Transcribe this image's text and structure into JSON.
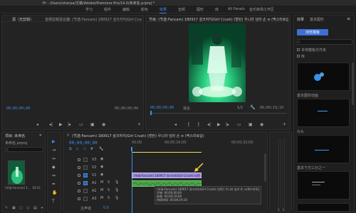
{
  "window": {
    "title": "Pr - /Users/sherpa/文稿/Adobe/Premiere Pro/14.0/未命名.prproj *"
  },
  "menu": {
    "items": [
      {
        "label": "学习"
      },
      {
        "label": "组件"
      },
      {
        "label": "编辑"
      },
      {
        "label": "颜色"
      },
      {
        "label": "效果"
      },
      {
        "label": "音频"
      },
      {
        "label": "图形"
      },
      {
        "label": "库"
      },
      {
        "label": "All Panels"
      },
      {
        "label": "音乐转场工作区"
      }
    ],
    "active_index": 4
  },
  "source_panel": {
    "tab_label": "源（无剪辑）",
    "tab2_label": "音频剪辑混合器: (节选-Fancam) 180917 설크자지(Girl Crush)",
    "timecode_left": "00;00;00;00",
    "timecode_right": "00;00;00;00"
  },
  "program_panel": {
    "tab_label": "节目: (节选-Fancam) 180917 설크자지(Girl Crush) (방탄) 우니라 넘라 손 ≡ (찍스미로샵)",
    "timecode_left": "00;00;00;00",
    "fit_label": "适合",
    "scale_label": "1/2",
    "timecode_right": "00;00;19;10"
  },
  "effects_panel": {
    "tab1": "效果",
    "tab2": "基本图形",
    "browse_button": "浏览模板",
    "my_templates": "本地模板文件夹",
    "checkbox_label": "库",
    "section_labels": [
      "基本图形动画",
      "片头",
      "基本下方三分之一"
    ]
  },
  "project_panel": {
    "tab_label": "项目: 未命名",
    "file_label": "未命名.prproj",
    "search_placeholder": "",
    "clip_label": "(节选-Fancam) 1...",
    "clip_duration": "19;10"
  },
  "timeline": {
    "tab_label": "(节选-Fancam) 180917 설크자지(Girl Crush) (방탄) 우니라 넘라 손 ≡ (찍스미로샵)",
    "timecode": "00;00;00;00",
    "ruler": [
      "00;00",
      "00;00;16;00",
      "00;00;32;00"
    ],
    "tracks": [
      {
        "name": "V3"
      },
      {
        "name": "V2"
      },
      {
        "name": "V1"
      },
      {
        "name": "A1"
      },
      {
        "name": "A2"
      },
      {
        "name": "A3"
      }
    ],
    "master_label": "主声道",
    "master_value": "0.0",
    "clip_video_label": "(节选-Fancam) 180917 설크자지(Girl Crush) (방탄) 우니라 넘라 ≡ [V]",
    "tooltip_lines": [
      "(节选-Fancam) 180917 설크자지(Girl Crush) (방탄) 우니라 넘라 손 ≡(찍스미로샵).mp4",
      "开始: 00;00;00;00",
      "结束: 00;00;19;09",
      "持续时间: 00;00;19;10"
    ]
  },
  "colors": {
    "accent": "#3d8fe6",
    "clip_video": "#9f8fe0",
    "clip_audio": "#4aa34a",
    "playhead": "#3d8fe6",
    "work_area": "#e8e05a"
  }
}
